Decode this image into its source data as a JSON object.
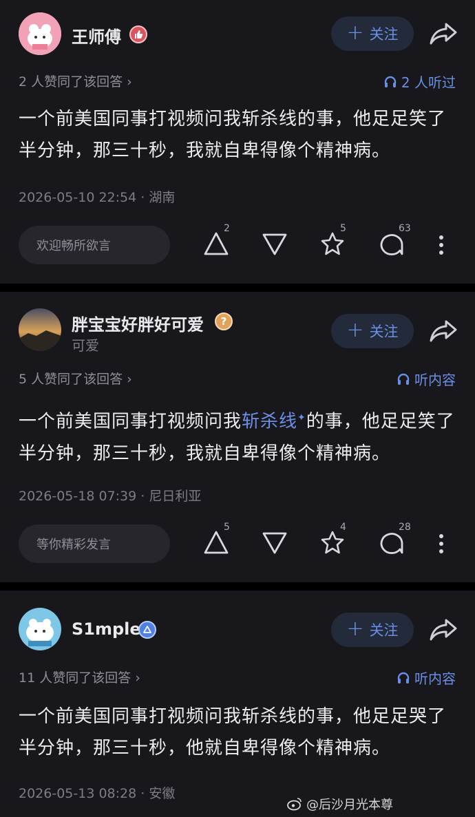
{
  "posts": [
    {
      "username": "王师傅",
      "follow_label": "关注",
      "agree_text": "2 人赞同了该回答 ›",
      "listen_text": "2 人听过",
      "content": "一个前美国同事打视频问我斩杀线的事，他足足笑了半分钟，那三十秒，我就自卑得像个精神病。",
      "meta": "2026-05-10 22:54 · 湖南",
      "comment_placeholder": "欢迎畅所欲言",
      "up_count": "2",
      "star_count": "5",
      "comment_count": "63"
    },
    {
      "username": "胖宝宝好胖好可爱",
      "user_sub": "可爱",
      "follow_label": "关注",
      "agree_text": "5 人赞同了该回答 ›",
      "listen_text": "听内容",
      "content_before": "一个前美国同事打视频问我",
      "content_highlight": "斩杀线",
      "content_after": "的事，他足足笑了半分钟，那三十秒，我就自卑得像个精神病。",
      "meta": "2026-05-18 07:39 · 尼日利亚",
      "comment_placeholder": "等你精彩发言",
      "up_count": "5",
      "star_count": "4",
      "comment_count": "28"
    },
    {
      "username": "S1mple",
      "follow_label": "关注",
      "agree_text": "11 人赞同了该回答 ›",
      "listen_text": "听内容",
      "content": "一个前美国同事打视频问我斩杀线的事，他足足哭了半分钟，那三十秒，他就自卑得像个精神病。",
      "meta": "2026-05-13 08:28 · 安徽"
    }
  ],
  "watermark": "@后沙月光本尊",
  "colors": {
    "accent": "#6a8fe6",
    "card_bg": "#18181c",
    "page_bg": "#000000"
  },
  "icons": [
    "avatar-image",
    "thumbs-badge-icon",
    "question-badge-icon",
    "verified-badge-icon",
    "share-arrow-icon",
    "headphones-icon",
    "upvote-icon",
    "downvote-icon",
    "star-icon",
    "comment-icon",
    "more-icon",
    "weibo-logo-icon"
  ]
}
